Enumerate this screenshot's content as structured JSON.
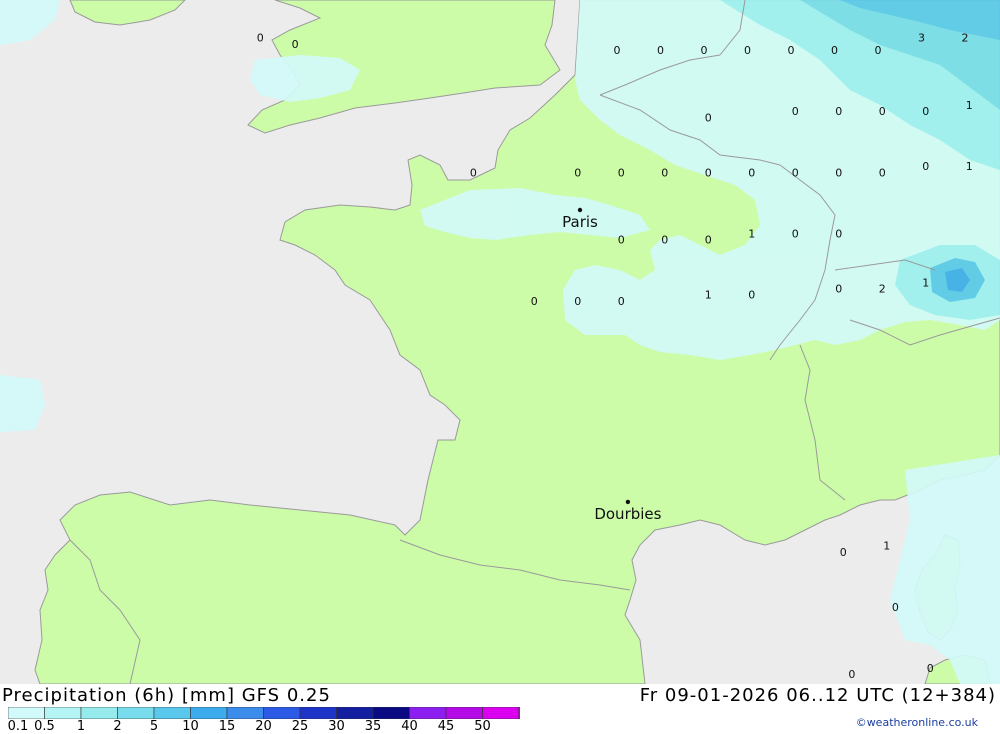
{
  "map": {
    "precip_values": [
      {
        "text": "0",
        "lon": -5.0,
        "lat": 51.6
      },
      {
        "text": "0",
        "lon": -4.2,
        "lat": 51.5
      },
      {
        "text": "0",
        "lon": 3.3,
        "lat": 52.5
      },
      {
        "text": "0",
        "lon": 4.1,
        "lat": 52.5
      },
      {
        "text": "0",
        "lon": 5.1,
        "lat": 52.5
      },
      {
        "text": "0",
        "lon": 6.2,
        "lat": 52.5
      },
      {
        "text": "1",
        "lon": 7.2,
        "lat": 52.5
      },
      {
        "text": "2",
        "lon": 8.3,
        "lat": 52.6
      },
      {
        "text": "2",
        "lon": 9.3,
        "lat": 52.6
      },
      {
        "text": "3",
        "lon": 10.3,
        "lat": 52.7
      },
      {
        "text": "2",
        "lon": 11.3,
        "lat": 52.7
      },
      {
        "text": "0",
        "lon": 3.2,
        "lat": 51.4
      },
      {
        "text": "0",
        "lon": 4.2,
        "lat": 51.4
      },
      {
        "text": "0",
        "lon": 5.2,
        "lat": 51.4
      },
      {
        "text": "0",
        "lon": 6.2,
        "lat": 51.4
      },
      {
        "text": "0",
        "lon": 7.2,
        "lat": 51.4
      },
      {
        "text": "0",
        "lon": 8.2,
        "lat": 51.4
      },
      {
        "text": "0",
        "lon": 9.2,
        "lat": 51.4
      },
      {
        "text": "3",
        "lon": 10.2,
        "lat": 51.6
      },
      {
        "text": "2",
        "lon": 11.2,
        "lat": 51.6
      },
      {
        "text": "0",
        "lon": 5.3,
        "lat": 50.3
      },
      {
        "text": "0",
        "lon": 7.3,
        "lat": 50.4
      },
      {
        "text": "0",
        "lon": 8.3,
        "lat": 50.4
      },
      {
        "text": "0",
        "lon": 9.3,
        "lat": 50.4
      },
      {
        "text": "0",
        "lon": 10.3,
        "lat": 50.4
      },
      {
        "text": "1",
        "lon": 11.3,
        "lat": 50.5
      },
      {
        "text": "0",
        "lon": -0.1,
        "lat": 49.4
      },
      {
        "text": "0",
        "lon": 2.3,
        "lat": 49.4
      },
      {
        "text": "0",
        "lon": 3.3,
        "lat": 49.4
      },
      {
        "text": "0",
        "lon": 4.3,
        "lat": 49.4
      },
      {
        "text": "0",
        "lon": 5.3,
        "lat": 49.4
      },
      {
        "text": "0",
        "lon": 6.3,
        "lat": 49.4
      },
      {
        "text": "0",
        "lon": 7.3,
        "lat": 49.4
      },
      {
        "text": "0",
        "lon": 8.3,
        "lat": 49.4
      },
      {
        "text": "0",
        "lon": 9.3,
        "lat": 49.4
      },
      {
        "text": "0",
        "lon": 10.3,
        "lat": 49.5
      },
      {
        "text": "1",
        "lon": 11.3,
        "lat": 49.5
      },
      {
        "text": "0",
        "lon": 3.3,
        "lat": 48.3
      },
      {
        "text": "0",
        "lon": 4.3,
        "lat": 48.3
      },
      {
        "text": "0",
        "lon": 5.3,
        "lat": 48.3
      },
      {
        "text": "1",
        "lon": 6.3,
        "lat": 48.4
      },
      {
        "text": "0",
        "lon": 7.3,
        "lat": 48.4
      },
      {
        "text": "0",
        "lon": 8.3,
        "lat": 48.4
      },
      {
        "text": "0",
        "lon": 1.3,
        "lat": 47.3
      },
      {
        "text": "0",
        "lon": 2.3,
        "lat": 47.3
      },
      {
        "text": "0",
        "lon": 3.3,
        "lat": 47.3
      },
      {
        "text": "1",
        "lon": 5.3,
        "lat": 47.4
      },
      {
        "text": "0",
        "lon": 6.3,
        "lat": 47.4
      },
      {
        "text": "0",
        "lon": 8.3,
        "lat": 47.5
      },
      {
        "text": "2",
        "lon": 9.3,
        "lat": 47.5
      },
      {
        "text": "1",
        "lon": 10.3,
        "lat": 47.6
      },
      {
        "text": "0",
        "lon": -12.0,
        "lat": 45.3
      },
      {
        "text": "0",
        "lon": 8.4,
        "lat": 43.2
      },
      {
        "text": "1",
        "lon": 9.4,
        "lat": 43.3
      },
      {
        "text": "0",
        "lon": 9.6,
        "lat": 42.3
      },
      {
        "text": "0",
        "lon": 8.6,
        "lat": 41.2
      },
      {
        "text": "0",
        "lon": 10.4,
        "lat": 41.3
      },
      {
        "text": "0",
        "lon": 8.6,
        "lat": 40.2
      }
    ],
    "cities": [
      {
        "name": "Paris",
        "lon": 2.35,
        "lat": 48.85
      },
      {
        "name": "Dourbies",
        "lon": 3.45,
        "lat": 44.08
      }
    ],
    "colors": {
      "sea": "#ececec",
      "land": "#ccfca8",
      "border": "#9a9a9a"
    }
  },
  "footer": {
    "title_left": "Precipitation (6h) [mm] GFS 0.25",
    "title_right": "Fr 09-01-2026 06..12 UTC (12+384)",
    "credit": "©weatheronline.co.uk",
    "legend_labels": [
      "0.1",
      "0.5",
      "1",
      "2",
      "5",
      "10",
      "15",
      "20",
      "25",
      "30",
      "35",
      "40",
      "45",
      "50"
    ],
    "legend_colors": [
      "#d2fafa",
      "#b4f4f4",
      "#96ecec",
      "#78dcec",
      "#5ac8ec",
      "#3cacec",
      "#3c8cec",
      "#2c5ae6",
      "#1e34c8",
      "#141ea0",
      "#0a0a82",
      "#8c1ef0",
      "#b40ae6",
      "#dc00f0",
      "#e600d2",
      "#c80096"
    ]
  }
}
